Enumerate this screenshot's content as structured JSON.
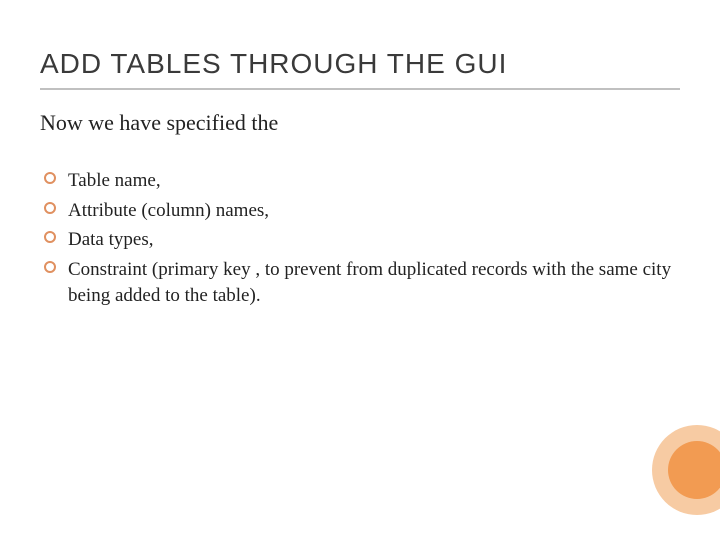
{
  "slide": {
    "title": "ADD TABLES THROUGH THE GUI",
    "intro": "Now we have specified the",
    "bullets": [
      "Table name,",
      "Attribute (column) names,",
      "Data types,",
      "Constraint (primary key , to prevent from duplicated records with the same city being added to the table)."
    ]
  },
  "colors": {
    "accent": "#f29b52",
    "accent_light": "#f7cba3",
    "title_underline": "#c0c0c0"
  }
}
